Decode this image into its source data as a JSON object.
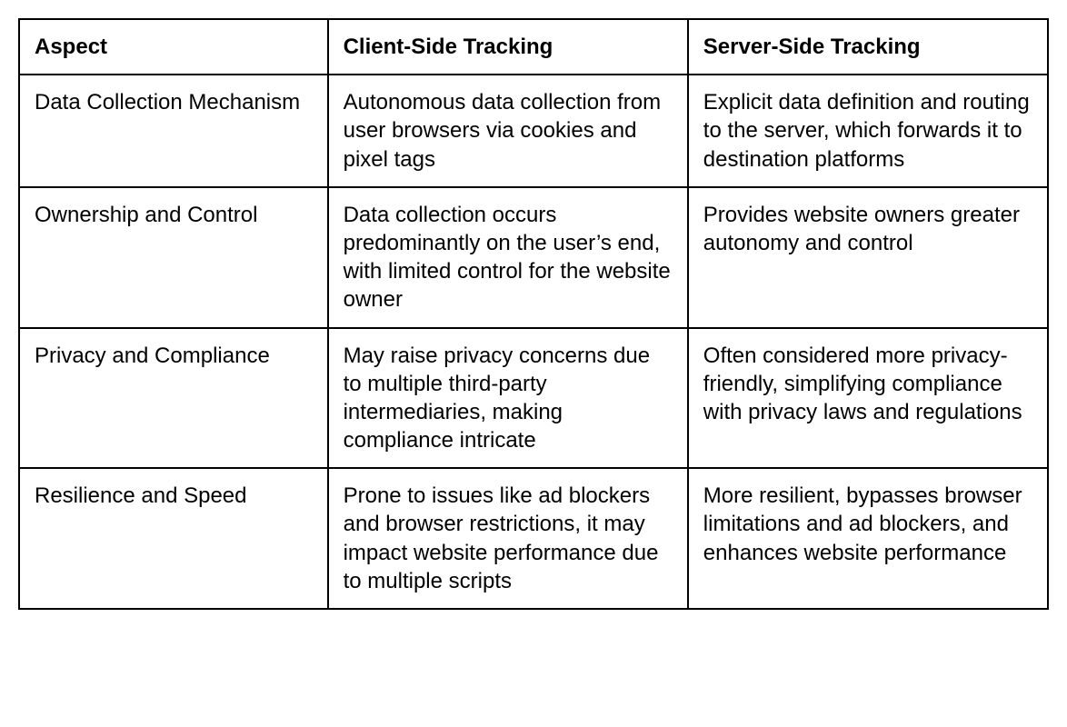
{
  "chart_data": {
    "type": "table",
    "headers": [
      "Aspect",
      "Client-Side Tracking",
      "Server-Side Tracking"
    ],
    "rows": [
      {
        "aspect": "Data Collection Mechanism",
        "client": "Autonomous data collection from user browsers via cookies and pixel tags",
        "server": "Explicit data definition and routing to the server, which forwards it to destination platforms"
      },
      {
        "aspect": "Ownership and Control",
        "client": "Data collection occurs predominantly on the user’s end, with limited control for the website owner",
        "server": "Provides website owners greater autonomy and control"
      },
      {
        "aspect": "Privacy and Compliance",
        "client": "May raise privacy concerns due to multiple third-party intermediaries, making compliance intricate",
        "server": "Often considered more privacy-friendly, simplifying compliance with privacy laws and regulations"
      },
      {
        "aspect": "Resilience and Speed",
        "client": "Prone to issues like ad blockers and browser restrictions, it may impact website performance due to multiple scripts",
        "server": "More resilient, bypasses browser limitations and ad blockers, and enhances website performance"
      }
    ]
  }
}
